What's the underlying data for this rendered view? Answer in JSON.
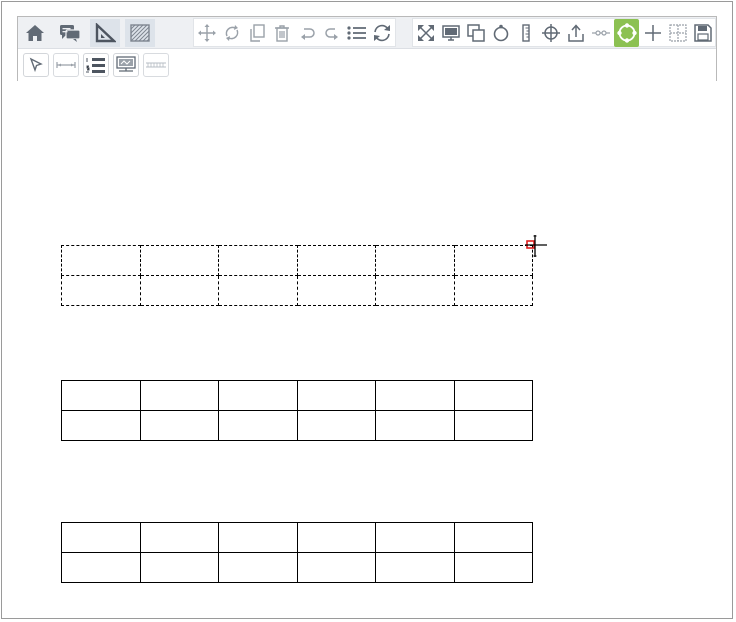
{
  "toolbar": {
    "modes": [
      {
        "name": "home-icon",
        "active": false
      },
      {
        "name": "chat-icon",
        "active": false
      },
      {
        "name": "geometry-ruler-icon",
        "active": true
      },
      {
        "name": "hatch-fill-icon",
        "active": true
      }
    ],
    "edit_group": [
      "move-icon",
      "rotate-icon",
      "copy-icon",
      "delete-icon",
      "undo-icon",
      "redo-icon",
      "list-icon",
      "refresh-icon"
    ],
    "view_group": [
      "fullscreen-icon",
      "monitor-icon",
      "layers-icon",
      "circle-icon",
      "ruler-icon",
      "crosshair-icon",
      "upload-icon",
      "segment-icon",
      "circle-points-icon",
      "plus-icon",
      "grid-icon",
      "save-icon"
    ],
    "selected_tool": "circle-points-icon",
    "second_row": [
      "pointer-icon",
      "dimension-line-icon",
      "numbered-list-icon",
      "display-icon",
      "hatch-line-icon"
    ],
    "accent_color": "#8cc152"
  },
  "tables": [
    {
      "style": "dashed",
      "rows": 2,
      "cols": 6
    },
    {
      "style": "solid",
      "rows": 2,
      "cols": 6
    },
    {
      "style": "solid",
      "rows": 2,
      "cols": 6
    }
  ],
  "cursor_color": "#e02020"
}
